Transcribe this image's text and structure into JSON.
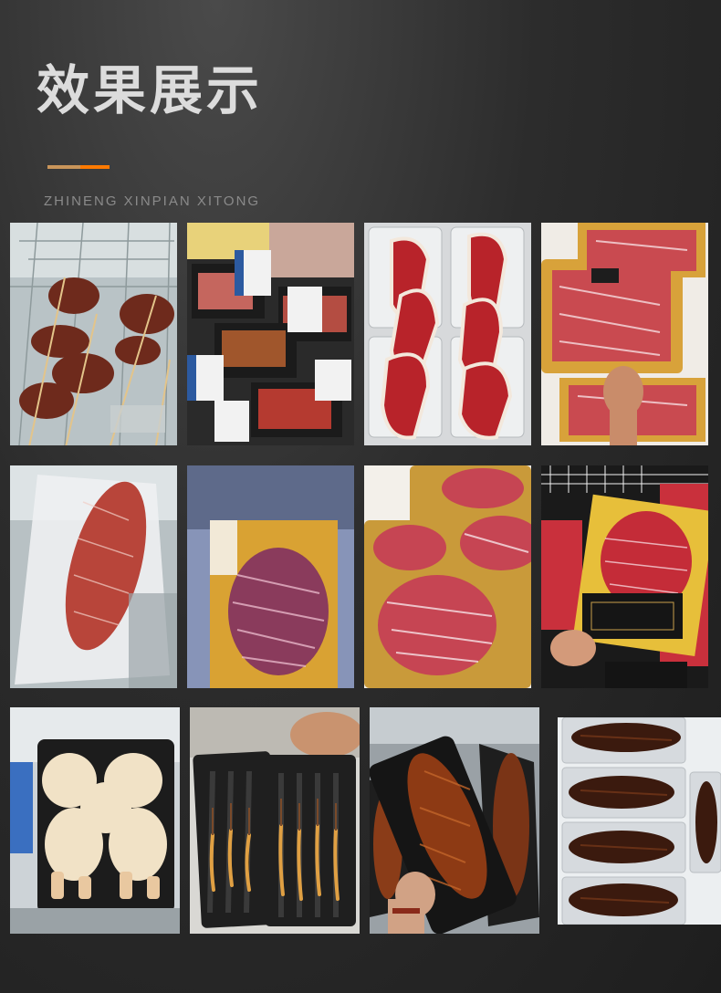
{
  "header": {
    "title": "效果展示",
    "subtitle": "ZHINENG XINPIAN XITONG"
  },
  "photos": [
    {
      "subject": "skewered meat in display freezer"
    },
    {
      "subject": "packaged sliced meats with labels"
    },
    {
      "subject": "marbled steaks in clear trays"
    },
    {
      "subject": "wagyu slices on gold trays"
    },
    {
      "subject": "vacuum packed wagyu steak"
    },
    {
      "subject": "marbled steak on gold tray"
    },
    {
      "subject": "steaks on gold trays"
    },
    {
      "subject": "beef slices in gold box"
    },
    {
      "subject": "whole chickens in black tray"
    },
    {
      "subject": "cordyceps in black trays"
    },
    {
      "subject": "grilled eel in black tray"
    },
    {
      "subject": "grilled eel fillets in trays"
    }
  ]
}
